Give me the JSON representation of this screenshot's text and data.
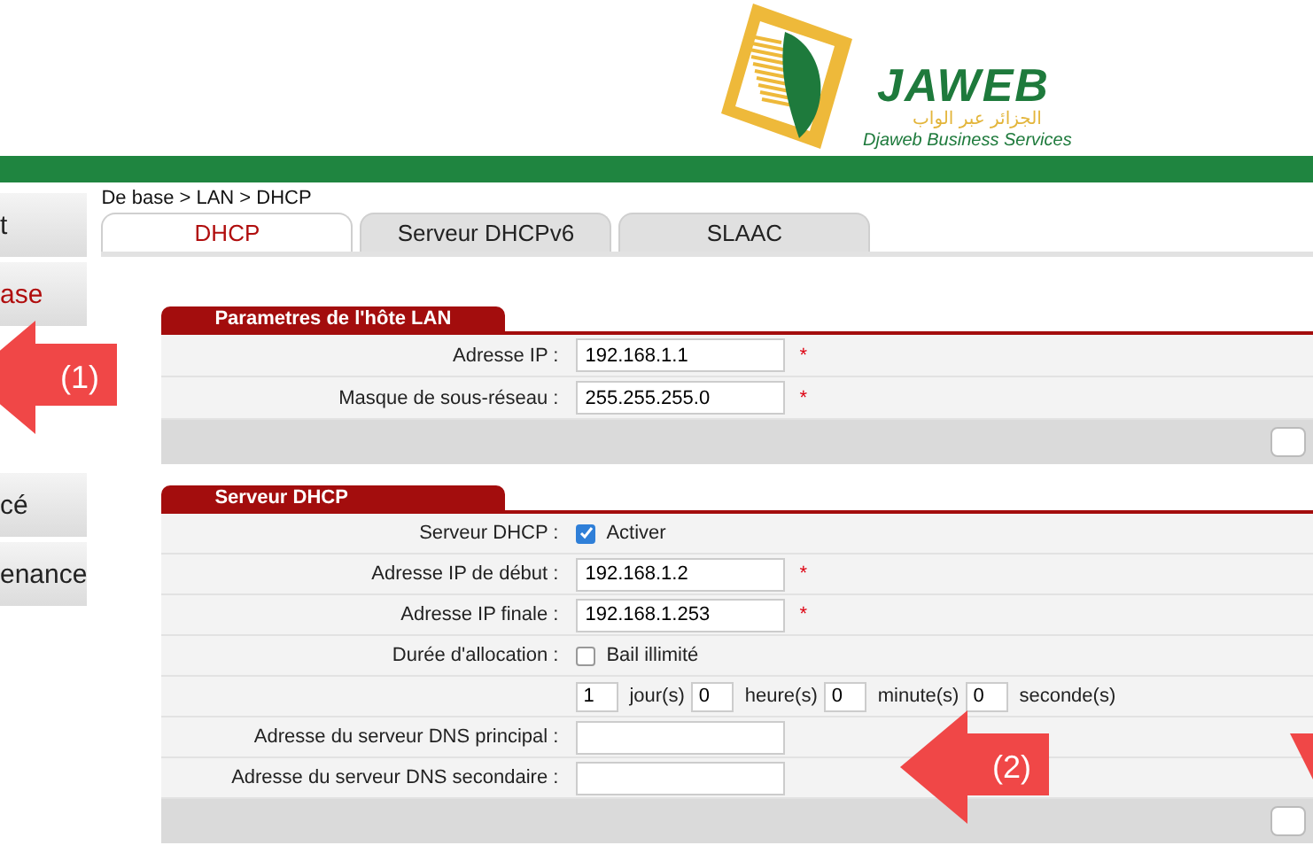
{
  "logo": {
    "name": "JAWEB",
    "arabic": "الجزائر عبر الواب",
    "tagline": "Djaweb Business Services"
  },
  "sidebar": {
    "items": [
      {
        "label": "t",
        "selected": false
      },
      {
        "label": "ase",
        "selected": true
      },
      {
        "label": "cé",
        "selected": false
      },
      {
        "label": "enance",
        "selected": false
      }
    ]
  },
  "breadcrumb": "De base > LAN > DHCP",
  "tabs": [
    {
      "label": "DHCP",
      "selected": true
    },
    {
      "label": "Serveur DHCPv6",
      "selected": false
    },
    {
      "label": "SLAAC",
      "selected": false
    }
  ],
  "sections": [
    {
      "title": "Parametres de l'hôte LAN",
      "rows": [
        {
          "kind": "input",
          "label": "Adresse IP :",
          "value": "192.168.1.1",
          "required": "*"
        },
        {
          "kind": "input",
          "label": "Masque de sous-réseau :",
          "value": "255.255.255.0",
          "required": "*"
        }
      ]
    },
    {
      "title": "Serveur DHCP",
      "rows": [
        {
          "kind": "checkbox",
          "label": "Serveur DHCP :",
          "option": "Activer",
          "checked": true
        },
        {
          "kind": "input",
          "label": "Adresse IP de début :",
          "value": "192.168.1.2",
          "required": "*"
        },
        {
          "kind": "input",
          "label": "Adresse IP finale :",
          "value": "192.168.1.253",
          "required": "*"
        },
        {
          "kind": "checkbox",
          "label": "Durée d'allocation :",
          "option": "Bail illimité",
          "checked": false
        },
        {
          "kind": "lease",
          "parts": [
            {
              "value": "1",
              "unit": "jour(s)"
            },
            {
              "value": "0",
              "unit": "heure(s)"
            },
            {
              "value": "0",
              "unit": "minute(s)"
            },
            {
              "value": "0",
              "unit": "seconde(s)"
            }
          ]
        },
        {
          "kind": "input",
          "label": "Adresse du serveur DNS principal :"
        },
        {
          "kind": "input",
          "label": "Adresse du serveur DNS secondaire :"
        }
      ]
    }
  ],
  "annotations": [
    {
      "label": "(1)"
    },
    {
      "label": "(2)"
    }
  ]
}
